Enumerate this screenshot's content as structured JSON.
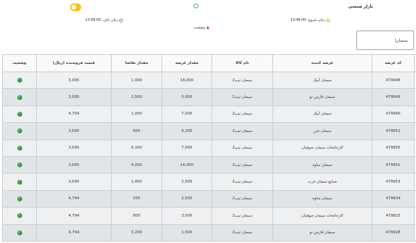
{
  "header": {
    "title": "بازار صنعتی",
    "start_time_label": "زمان شروع: 13:40:00",
    "end_time_label": "زمان پایان: 13:49:00",
    "status_label": "وضعیت:"
  },
  "search": {
    "value": "سیمان|"
  },
  "table": {
    "columns": [
      "",
      "کد عرضه",
      "عرضه کننده",
      "نام کالا",
      "مقدار عرضه",
      "مقدار تقاضا",
      "قیمت فروشنده (ریال)",
      "وضعیت"
    ],
    "rows": [
      {
        "code": "479948",
        "supplier": "سیمان آبیک",
        "product": "سیمان تیپ2",
        "offer": "18,000",
        "demand": "1,000",
        "price": "3,095"
      },
      {
        "code": "479949",
        "supplier": "سیمان فارس نو",
        "product": "سیمان تیپ2",
        "offer": "5,000",
        "demand": "2,500",
        "price": "3,095"
      },
      {
        "code": "479940",
        "supplier": "سیمان آبیک",
        "product": "سیمان تیپ2",
        "offer": "7,000",
        "demand": "1,000",
        "price": "4,794"
      },
      {
        "code": "479952",
        "supplier": "سیمان خزر",
        "product": "سیمان تیپ2",
        "offer": "4,200",
        "demand": "600",
        "price": "3,095"
      },
      {
        "code": "479955",
        "supplier": "کارخانجات سیمان صوفیان",
        "product": "سیمان تیپ2",
        "offer": "7,000",
        "demand": "6,100",
        "price": "3,095"
      },
      {
        "code": "479951",
        "supplier": "سیمان ساوه",
        "product": "سیمان تیپ2",
        "offer": "14,000",
        "demand": "4,000",
        "price": "3,095"
      },
      {
        "code": "479953",
        "supplier": "صنایع سیمان غرب",
        "product": "سیمان تیپ2",
        "offer": "2,500",
        "demand": "1,000",
        "price": "3,095"
      },
      {
        "code": "479934",
        "supplier": "سیمان ساوه",
        "product": "سیمان تیپ2",
        "offer": "2,500",
        "demand": "500",
        "price": "4,794"
      },
      {
        "code": "479925",
        "supplier": "کارخانجات سیمان صوفیان",
        "product": "سیمان تیپ2",
        "offer": "3,000",
        "demand": "800",
        "price": "4,794"
      },
      {
        "code": "479928",
        "supplier": "سیمان فارس نو",
        "product": "سیمان تیپ2",
        "offer": "1,500",
        "demand": "3,200",
        "price": "4,794"
      }
    ]
  },
  "icons": {
    "expand": "plus-square-icon",
    "status": "check-circle-icon",
    "clock": "clock-icon"
  },
  "colors": {
    "toggle": "#f6c21a",
    "status_ok": "#2e9f45"
  }
}
